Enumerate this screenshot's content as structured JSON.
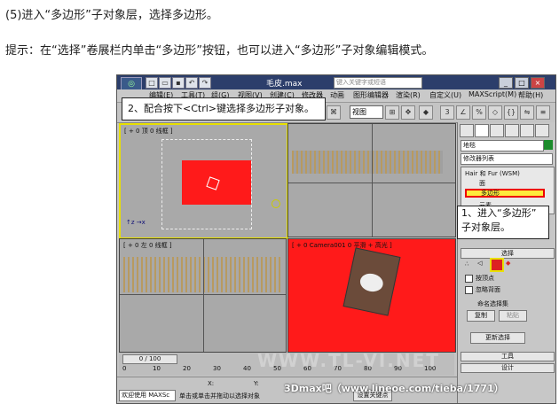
{
  "instructions": {
    "step": "(5)进入“多边形”子对象层，选择多边形。",
    "tip": "提示：在“选择”卷展栏内单击“多边形”按钮，也可以进入“多边形”子对象编辑模式。"
  },
  "app": {
    "title": "毛皮.max",
    "search_placeholder": "键入关键字或短语",
    "menus": [
      "编辑(E)",
      "工具(T)",
      "组(G)",
      "视图(V)",
      "创建(C)",
      "修改器",
      "动画",
      "图形编辑器",
      "渲染(R)",
      "自定义(U)",
      "MAXScript(M)",
      "帮助(H)"
    ],
    "view_dropdown": "视图",
    "viewports": [
      {
        "label": "[ + 0 顶 0 线框 ]"
      },
      {
        "label": ""
      },
      {
        "label": "[ + 0 左 0 线框 ]"
      },
      {
        "label": "[ + 0 Camera001 0 平滑 + 高光 ]"
      }
    ],
    "command_panel": {
      "object_name": "地毯",
      "modifier_list": "修改器列表",
      "stack": [
        "Hair 和 Fur (WSM)",
        "面",
        "多边形",
        "元素"
      ],
      "selection_rollout": "选择",
      "by_vertex": "按顶点",
      "ignore_backfacing": "忽略背面",
      "named_selection": "命名选择集",
      "copy": "复制",
      "paste": "粘贴",
      "update_selection": "更新选择",
      "tools_rollout": "工具",
      "design_rollout": "设计"
    },
    "timeline": "0 / 100",
    "ticks": [
      "0",
      "10",
      "20",
      "30",
      "40",
      "50",
      "60",
      "70",
      "80",
      "90",
      "100"
    ],
    "status_text": "欢迎使用 MAXSc",
    "status_hint": "单击或单击并拖动以选择对象",
    "x_label": "X:",
    "y_label": "Y:",
    "keyset": "设置关键点"
  },
  "callouts": {
    "ctrl": "2、配合按下<Ctrl>键选择多边形子对象。",
    "polygon_line1": "1、进入“多边形”",
    "polygon_line2": "子对象层。"
  },
  "watermark": "3Dmax吧（www.lineoe.com/tieba/1771）",
  "watermark2": "WWW.TL-VI.NET"
}
